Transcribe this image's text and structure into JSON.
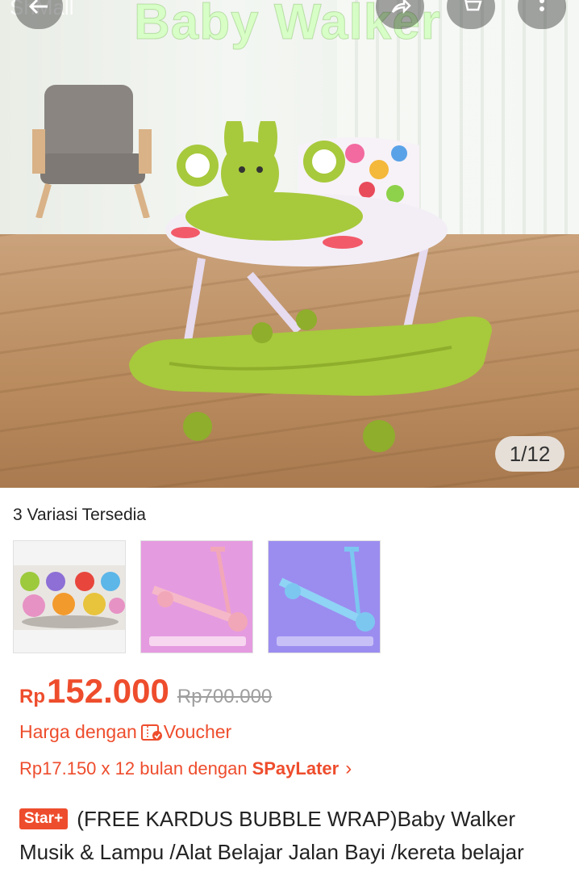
{
  "hero": {
    "watermark": "Baby Walker",
    "mall_label": "ShMall",
    "counter": "1/12"
  },
  "variations": {
    "label": "3 Variasi Tersedia",
    "items": [
      "variant-1",
      "variant-2",
      "variant-3"
    ]
  },
  "price": {
    "currency": "Rp",
    "value": "152.000",
    "original": "Rp700.000"
  },
  "voucher": {
    "prefix": "Harga dengan",
    "label": "Voucher"
  },
  "paylater": {
    "text": "Rp17.150 x 12 bulan dengan",
    "brand": "SPayLater",
    "chevron": "›"
  },
  "product": {
    "badge": "Star+",
    "title": "(FREE KARDUS BUBBLE WRAP)Baby Walker Musik & Lampu /Alat Belajar Jalan Bayi /kereta belajar"
  },
  "colors": {
    "accent": "#ee4d2d",
    "walker_green": "#a7c93c",
    "variant_pink": "#e59be0",
    "variant_purple": "#9b8df0"
  },
  "icons": [
    "back-arrow-icon",
    "share-icon",
    "cart-icon",
    "more-icon",
    "voucher-icon",
    "chevron-right-icon"
  ]
}
